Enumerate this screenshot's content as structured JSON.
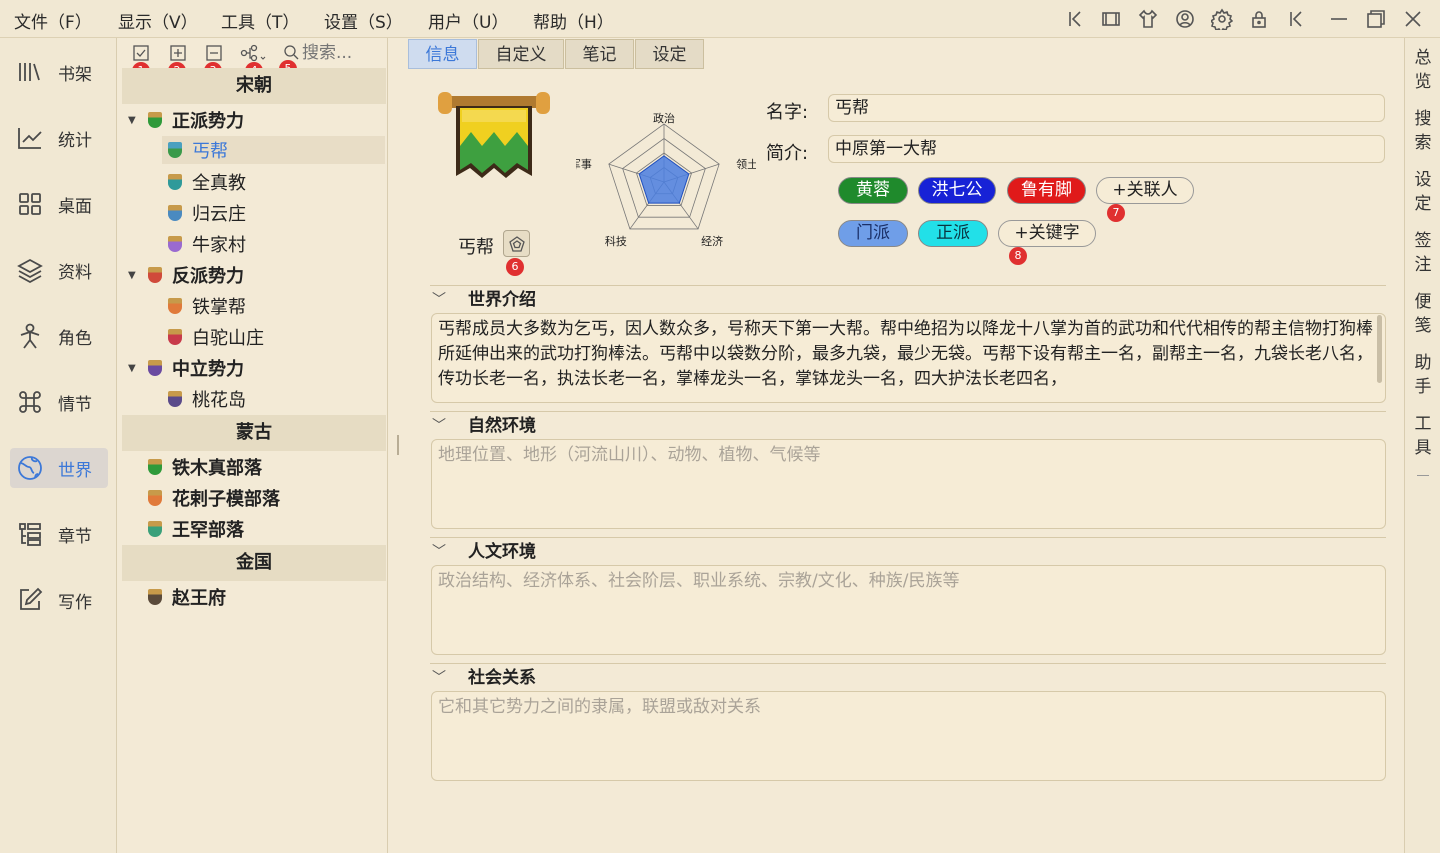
{
  "menu": [
    "文件（F）",
    "显示（V）",
    "工具（T）",
    "设置（S）",
    "用户（U）",
    "帮助（H）"
  ],
  "toolbar_icons": [
    "collapse-left-icon",
    "panel-icon",
    "shirt-icon",
    "user-circle-icon",
    "gear-icon",
    "lock-icon",
    "collapse-right-icon",
    "minimize-icon",
    "maximize-icon",
    "close-icon"
  ],
  "nav": [
    {
      "label": "书架",
      "icon": "bookshelf-icon"
    },
    {
      "label": "统计",
      "icon": "chart-icon"
    },
    {
      "label": "桌面",
      "icon": "grid-icon"
    },
    {
      "label": "资料",
      "icon": "layers-icon"
    },
    {
      "label": "角色",
      "icon": "person-icon"
    },
    {
      "label": "情节",
      "icon": "command-icon"
    },
    {
      "label": "世界",
      "icon": "globe-icon"
    },
    {
      "label": "章节",
      "icon": "list-icon"
    },
    {
      "label": "写作",
      "icon": "edit-icon"
    }
  ],
  "tree_toolbar": {
    "search_placeholder": "搜索...",
    "badges": [
      "1",
      "2",
      "3",
      "4",
      "5"
    ]
  },
  "tree": {
    "groups": [
      "宋朝",
      "蒙古",
      "金国"
    ],
    "nodes": [
      "正派势力",
      "丐帮",
      "全真教",
      "归云庄",
      "牛家村",
      "反派势力",
      "铁掌帮",
      "白驼山庄",
      "中立势力",
      "桃花岛",
      "铁木真部落",
      "花剌子模部落",
      "王罕部落",
      "赵王府"
    ]
  },
  "tabs": [
    "信息",
    "自定义",
    "笔记",
    "设定"
  ],
  "info": {
    "emblem_name": "丐帮",
    "radar_labels": [
      "政治",
      "领土",
      "经济",
      "科技",
      "军事"
    ],
    "radar_values": [
      0.45,
      0.45,
      0.45,
      0.45,
      0.45
    ],
    "name_label": "名字:",
    "name_value": "丐帮",
    "intro_label": "简介:",
    "intro_value": "中原第一大帮",
    "people": [
      {
        "name": "黄蓉",
        "bg": "#1f8a2c",
        "fg": "#ffffff"
      },
      {
        "name": "洪七公",
        "bg": "#1722d6",
        "fg": "#ffffff"
      },
      {
        "name": "鲁有脚",
        "bg": "#e01a1a",
        "fg": "#ffffff"
      }
    ],
    "add_person": "+关联人",
    "keywords": [
      {
        "name": "门派",
        "bg": "#6f9ee8",
        "fg": "#1a2f66"
      },
      {
        "name": "正派",
        "bg": "#22e0e8",
        "fg": "#0a3340"
      }
    ],
    "add_keyword": "+关键字",
    "badges": [
      "6",
      "7",
      "8"
    ]
  },
  "sections": [
    {
      "title": "世界介绍",
      "text": "丐帮成员大多数为乞丐，因人数众多，号称天下第一大帮。帮中绝招为以降龙十八掌为首的武功和代代相传的帮主信物打狗棒所延伸出来的武功打狗棒法。丐帮中以袋数分阶，最多九袋，最少无袋。丐帮下设有帮主一名，副帮主一名，九袋长老八名，传功长老一名，执法长老一名，掌棒龙头一名，掌钵龙头一名，四大护法长老四名，",
      "placeholder": ""
    },
    {
      "title": "自然环境",
      "text": "",
      "placeholder": "地理位置、地形（河流山川）、动物、植物、气候等"
    },
    {
      "title": "人文环境",
      "text": "",
      "placeholder": "政治结构、经济体系、社会阶层、职业系统、宗教/文化、种族/民族等"
    },
    {
      "title": "社会关系",
      "text": "",
      "placeholder": "它和其它势力之间的隶属，联盟或敌对关系"
    }
  ],
  "rightbar": [
    "总览",
    "搜索",
    "设定",
    "签注",
    "便笺",
    "助手",
    "工具"
  ]
}
